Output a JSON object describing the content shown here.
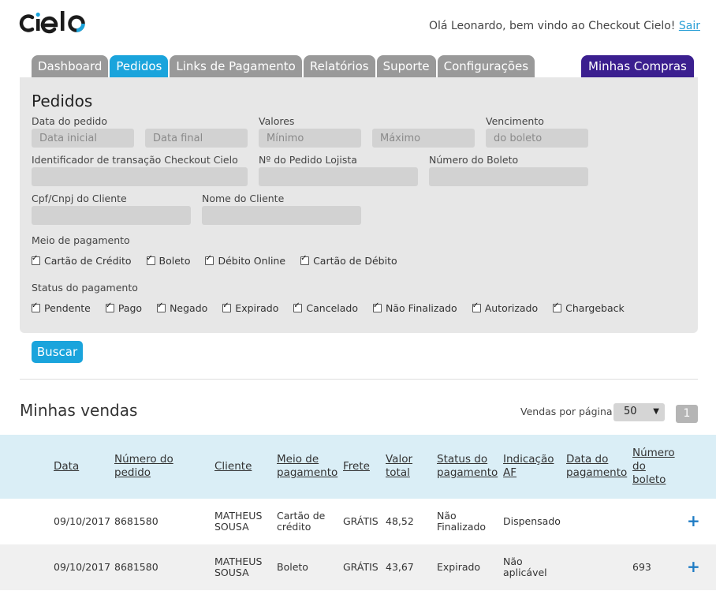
{
  "header": {
    "logo_text": "cielo",
    "greeting": "Olá Leonardo, bem vindo ao Checkout Cielo!",
    "logout_label": "Sair"
  },
  "tabs": [
    {
      "label": "Dashboard",
      "active": false
    },
    {
      "label": "Pedidos",
      "active": true
    },
    {
      "label": "Links de Pagamento",
      "active": false
    },
    {
      "label": "Relatórios",
      "active": false
    },
    {
      "label": "Suporte",
      "active": false
    },
    {
      "label": "Configurações",
      "active": false
    }
  ],
  "tab_right": "Minhas Compras",
  "filters": {
    "title": "Pedidos",
    "date_label": "Data do pedido",
    "date_start_placeholder": "Data inicial",
    "date_end_placeholder": "Data final",
    "values_label": "Valores",
    "min_placeholder": "Mínimo",
    "max_placeholder": "Máximo",
    "due_label": "Vencimento",
    "due_placeholder": "do boleto",
    "txid_label": "Identificador de transação Checkout Cielo",
    "order_label": "Nº do Pedido Lojista",
    "boleto_label": "Número do Boleto",
    "cpf_label": "Cpf/Cnpj do Cliente",
    "name_label": "Nome do Cliente",
    "payment_method_label": "Meio de pagamento",
    "payment_methods": [
      "Cartão de Crédito",
      "Boleto",
      "Débito Online",
      "Cartão de Débito"
    ],
    "payment_status_label": "Status do pagamento",
    "payment_statuses": [
      "Pendente",
      "Pago",
      "Negado",
      "Expirado",
      "Cancelado",
      "Não Finalizado",
      "Autorizado",
      "Chargeback"
    ],
    "search_button": "Buscar"
  },
  "sales": {
    "title": "Minhas vendas",
    "per_page_label": "Vendas por página",
    "per_page_value": "50",
    "page": "1",
    "columns": [
      "Data",
      "Número do pedido",
      "Cliente",
      "Meio de pagamento",
      "Frete",
      "Valor total",
      "Status do pagamento",
      "Indicação AF",
      "Data do pagamento",
      "Número do boleto"
    ],
    "rows": [
      {
        "date": "09/10/2017",
        "order": "8681580",
        "client": "MATHEUS SOUSA",
        "method": "Cartão de crédito",
        "shipping": "GRÁTIS",
        "total": "48,52",
        "status": "Não Finalizado",
        "af": "Dispensado",
        "paid_date": "",
        "boleto": ""
      },
      {
        "date": "09/10/2017",
        "order": "8681580",
        "client": "MATHEUS SOUSA",
        "method": "Boleto",
        "shipping": "GRÁTIS",
        "total": "43,67",
        "status": "Expirado",
        "af": "Não aplicável",
        "paid_date": "",
        "boleto": "693"
      }
    ]
  },
  "colors": {
    "accent": "#1aa4dc",
    "purple": "#3b1f8f",
    "header_row": "#daeef6",
    "stripe": "#f0f0f0"
  }
}
